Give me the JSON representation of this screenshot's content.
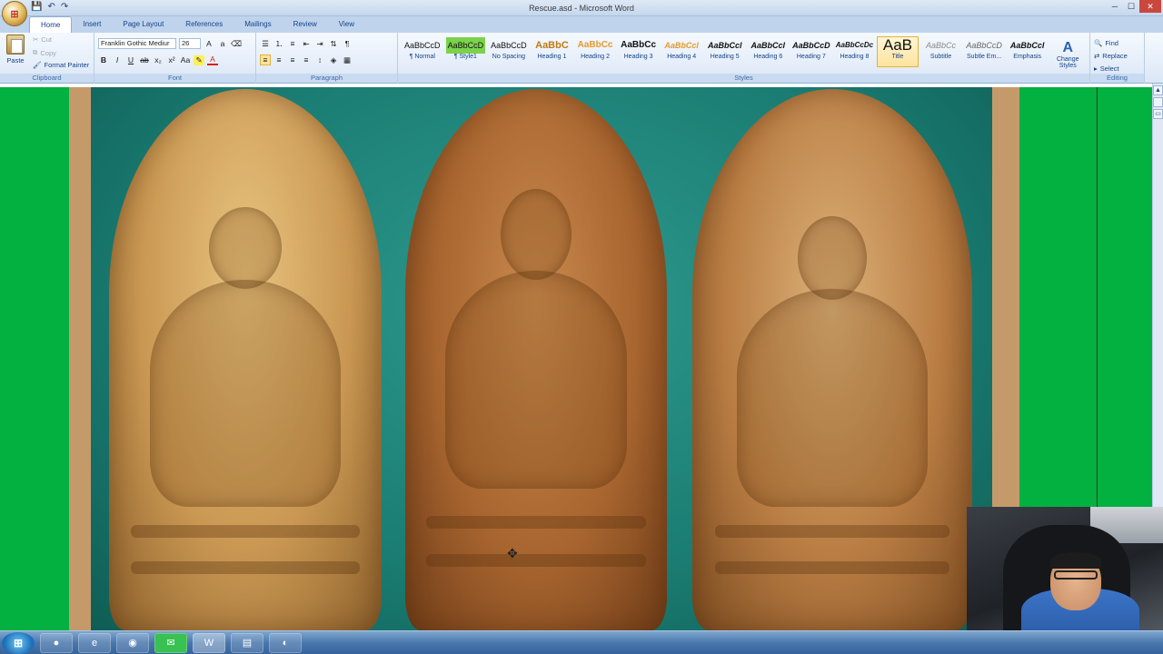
{
  "window": {
    "title": "Rescue.asd - Microsoft Word"
  },
  "quick_access": {
    "save": "💾",
    "undo": "↶",
    "redo": "↷"
  },
  "window_buttons": {
    "minimize": "─",
    "maximize": "☐",
    "close": "✕"
  },
  "tabs": [
    "Home",
    "Insert",
    "Page Layout",
    "References",
    "Mailings",
    "Review",
    "View"
  ],
  "clipboard": {
    "paste": "Paste",
    "cut": "Cut",
    "copy": "Copy",
    "format_painter": "Format Painter",
    "label": "Clipboard"
  },
  "font": {
    "family": "Franklin Gothic Mediur",
    "size": "26",
    "label": "Font"
  },
  "paragraph": {
    "label": "Paragraph"
  },
  "styles": {
    "label": "Styles",
    "items": [
      {
        "sample": "AaBbCcD",
        "name": "¶ Normal"
      },
      {
        "sample": "AaBbCcD",
        "name": "¶ Style1"
      },
      {
        "sample": "AaBbCcD",
        "name": "No Spacing"
      },
      {
        "sample": "AaBbC",
        "name": "Heading 1"
      },
      {
        "sample": "AaBbCc",
        "name": "Heading 2"
      },
      {
        "sample": "AaBbCc",
        "name": "Heading 3"
      },
      {
        "sample": "AaBbCcl",
        "name": "Heading 4"
      },
      {
        "sample": "AaBbCcl",
        "name": "Heading 5"
      },
      {
        "sample": "AaBbCcl",
        "name": "Heading 6"
      },
      {
        "sample": "AaBbCcD",
        "name": "Heading 7"
      },
      {
        "sample": "AaBbCcDc",
        "name": "Heading 8"
      },
      {
        "sample": "AaB",
        "name": "Title"
      },
      {
        "sample": "AaBbCc",
        "name": "Subtitle"
      },
      {
        "sample": "AaBbCcD",
        "name": "Subtle Em..."
      },
      {
        "sample": "AaBbCcl",
        "name": "Emphasis"
      }
    ],
    "change_styles": "Change Styles"
  },
  "editing": {
    "find": "Find",
    "replace": "Replace",
    "select": "Select",
    "label": "Editing"
  },
  "taskbar": {
    "apps": [
      "firefox-icon",
      "ie-icon",
      "chrome-icon",
      "line-icon",
      "word-icon",
      "notepad-icon",
      "app-icon"
    ]
  },
  "colors": {
    "page_bg": "#02b13f",
    "photo_bg": "#1a7c72",
    "margin": "#c59a6b",
    "highlight": "#fde39c"
  }
}
